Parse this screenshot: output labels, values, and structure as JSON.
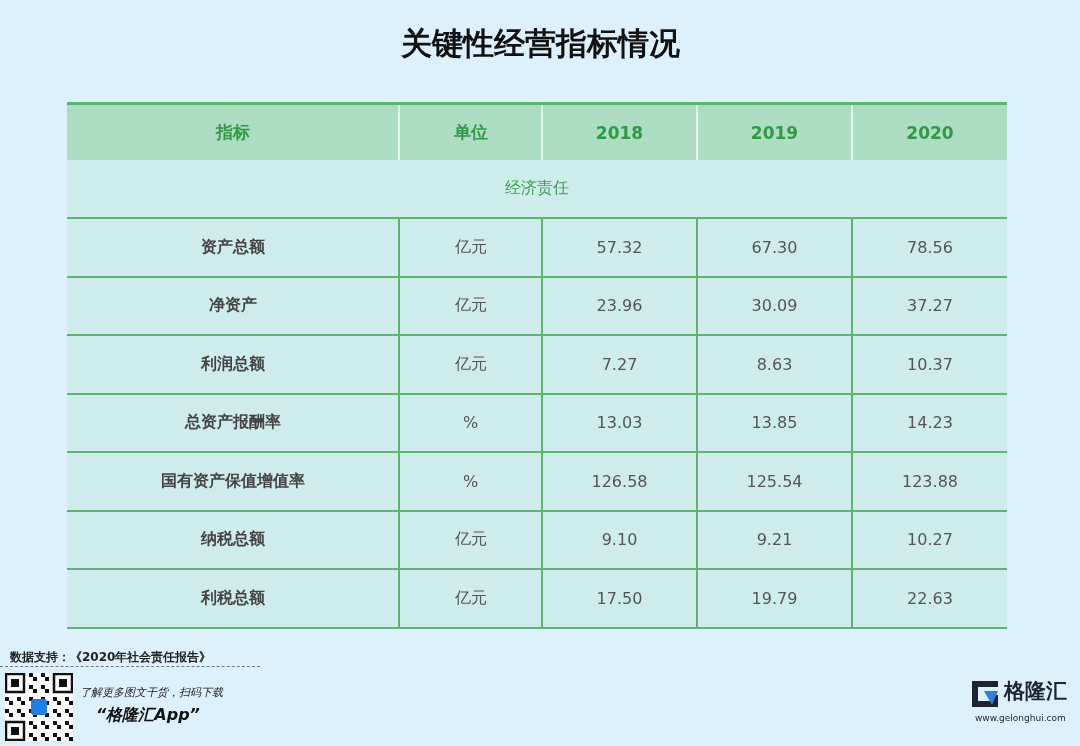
{
  "title": "关键性经营指标情况",
  "table": {
    "columns": [
      "指标",
      "单位",
      "2018",
      "2019",
      "2020"
    ],
    "section": "经济责任",
    "rows": [
      {
        "cells": [
          "资产总额",
          "亿元",
          "57.32",
          "67.30",
          "78.56"
        ]
      },
      {
        "cells": [
          "净资产",
          "亿元",
          "23.96",
          "30.09",
          "37.27"
        ]
      },
      {
        "cells": [
          "利润总额",
          "亿元",
          "7.27",
          "8.63",
          "10.37"
        ]
      },
      {
        "cells": [
          "总资产报酬率",
          "%",
          "13.03",
          "13.85",
          "14.23"
        ]
      },
      {
        "cells": [
          "国有资产保值增值率",
          "%",
          "126.58",
          "125.54",
          "123.88"
        ]
      },
      {
        "cells": [
          "纳税总额",
          "亿元",
          "9.10",
          "9.21",
          "10.27"
        ]
      },
      {
        "cells": [
          "利税总额",
          "亿元",
          "17.50",
          "19.79",
          "22.63"
        ]
      }
    ]
  },
  "source": "数据支持：《2020年社会责任报告》",
  "promo": {
    "line": "了解更多图文干货，扫码下载",
    "app": "“格隆汇App”"
  },
  "logo": {
    "name": "格隆汇",
    "url": "www.gelonghui.com"
  }
}
